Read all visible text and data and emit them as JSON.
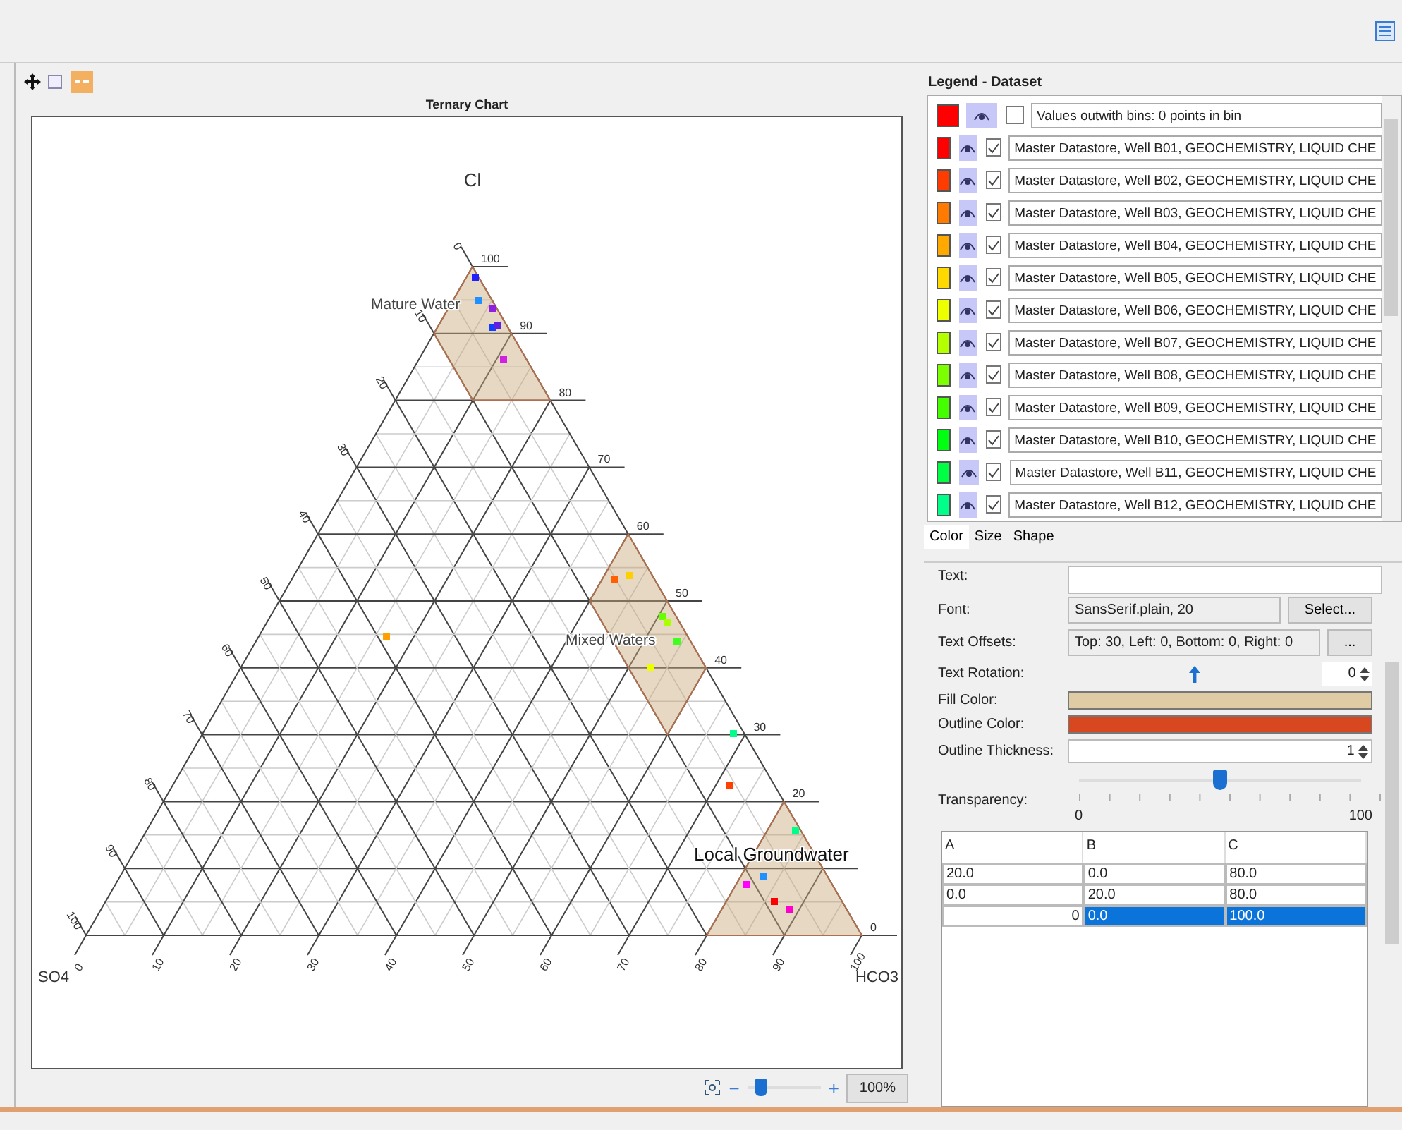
{
  "chart_panel": {
    "title": "Ternary Chart",
    "vertex_labels": {
      "top": "Cl",
      "left": "SO4",
      "right": "HCO3"
    },
    "right_ticks": [
      "0",
      "20",
      "30",
      "40",
      "50",
      "60",
      "70",
      "80",
      "90",
      "100"
    ],
    "left_ticks": [
      "0",
      "10",
      "20",
      "30",
      "40",
      "50",
      "60",
      "70",
      "80",
      "90",
      "100"
    ],
    "bottom_ticks": [
      "0",
      "10",
      "20",
      "30",
      "40",
      "50",
      "60",
      "70",
      "80",
      "90",
      "100"
    ],
    "regions": [
      {
        "label": "Mature Water",
        "kind": "small"
      },
      {
        "label": "Mixed Waters",
        "kind": "small"
      },
      {
        "label": "Local Groundwater",
        "kind": "large"
      }
    ],
    "zoom": {
      "minus": "−",
      "plus": "+",
      "level": 0.12,
      "value": "100%"
    }
  },
  "legend": {
    "title": "Legend - Dataset",
    "items": [
      {
        "color": "#ff0000",
        "checked": false,
        "label": "Values outwith bins: 0 points in bin"
      },
      {
        "color": "#ff0000",
        "checked": true,
        "label": "Master Datastore, Well B01, GEOCHEMISTRY, LIQUID CHE"
      },
      {
        "color": "#ff3c00",
        "checked": true,
        "label": "Master Datastore, Well B02, GEOCHEMISTRY, LIQUID CHE"
      },
      {
        "color": "#ff7a00",
        "checked": true,
        "label": "Master Datastore, Well B03, GEOCHEMISTRY, LIQUID CHE"
      },
      {
        "color": "#ffa800",
        "checked": true,
        "label": "Master Datastore, Well B04, GEOCHEMISTRY, LIQUID CHE"
      },
      {
        "color": "#ffd800",
        "checked": true,
        "label": "Master Datastore, Well B05, GEOCHEMISTRY, LIQUID CHE"
      },
      {
        "color": "#eeff00",
        "checked": true,
        "label": "Master Datastore, Well B06, GEOCHEMISTRY, LIQUID CHE"
      },
      {
        "color": "#b4ff00",
        "checked": true,
        "label": "Master Datastore, Well B07, GEOCHEMISTRY, LIQUID CHE"
      },
      {
        "color": "#7cff00",
        "checked": true,
        "label": "Master Datastore, Well B08, GEOCHEMISTRY, LIQUID CHE"
      },
      {
        "color": "#44ff00",
        "checked": true,
        "label": "Master Datastore, Well B09, GEOCHEMISTRY, LIQUID CHE"
      },
      {
        "color": "#00ff10",
        "checked": true,
        "label": "Master Datastore, Well B10, GEOCHEMISTRY, LIQUID CHE"
      },
      {
        "color": "#00ff44",
        "checked": true,
        "label": "Master Datastore, Well B11, GEOCHEMISTRY, LIQUID CHE"
      },
      {
        "color": "#00ff88",
        "checked": true,
        "label": "Master Datastore, Well B12, GEOCHEMISTRY, LIQUID CHE"
      }
    ],
    "tabs": [
      {
        "label": "Color",
        "selected": true
      },
      {
        "label": "Size",
        "selected": false
      },
      {
        "label": "Shape",
        "selected": false
      }
    ]
  },
  "properties": {
    "text_label": "Text:",
    "font": {
      "label": "Font:",
      "value": "SansSerif.plain, 20",
      "button": "Select..."
    },
    "offsets": {
      "label": "Text Offsets:",
      "value": "Top: 30, Left: 0, Bottom: 0, Right: 0",
      "button": "..."
    },
    "rotation": {
      "label": "Text Rotation:",
      "value": "0"
    },
    "fill": {
      "label": "Fill Color:",
      "color": "#e0cca4"
    },
    "outline": {
      "label": "Outline Color:",
      "color": "#d84820"
    },
    "thickness": {
      "label": "Outline Thickness:",
      "value": "1"
    },
    "transparency": {
      "label": "Transparency:",
      "level": 0.5,
      "min": "0",
      "max": "100"
    },
    "table": {
      "columns": [
        "A",
        "B",
        "C"
      ],
      "rows": [
        {
          "selected": false,
          "cells": [
            {
              "kind": "cell",
              "text": "20.0"
            },
            {
              "kind": "cell",
              "text": "0.0"
            },
            {
              "kind": "cell",
              "text": "80.0"
            }
          ]
        },
        {
          "selected": false,
          "cells": [
            {
              "kind": "cell",
              "text": "0.0"
            },
            {
              "kind": "cell",
              "text": "20.0"
            },
            {
              "kind": "cell",
              "text": "80.0"
            }
          ]
        },
        {
          "selected": true,
          "cells": [
            {
              "kind": "editor",
              "text": "0"
            },
            {
              "kind": "cell",
              "text": "0.0"
            },
            {
              "kind": "cell",
              "text": "100.0"
            }
          ]
        }
      ]
    }
  }
}
